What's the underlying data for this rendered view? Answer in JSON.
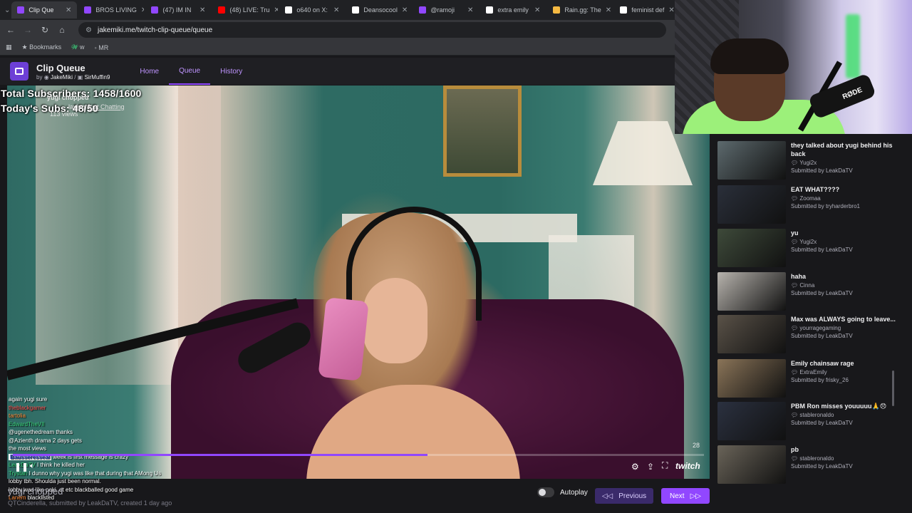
{
  "browser": {
    "tabs": [
      {
        "label": "Clip Que",
        "active": true,
        "color": "#9147ff"
      },
      {
        "label": "BROS LIVING",
        "active": false,
        "color": "#9147ff"
      },
      {
        "label": "(47) IM IN",
        "active": false,
        "color": "#9147ff"
      },
      {
        "label": "(48) LIVE: Tru",
        "active": false,
        "color": "#ff0000"
      },
      {
        "label": "o640 on X:",
        "active": false,
        "color": "#ffffff"
      },
      {
        "label": "Deansocool",
        "active": false,
        "color": "#ffffff"
      },
      {
        "label": "@ramoji",
        "active": false,
        "color": "#9147ff"
      },
      {
        "label": "extra emily",
        "active": false,
        "color": "#ffffff"
      },
      {
        "label": "Rain.gg: The",
        "active": false,
        "color": "#f5b942"
      },
      {
        "label": "feminist def",
        "active": false,
        "color": "#ffffff"
      }
    ],
    "url": "jakemiki.me/twitch-clip-queue/queue",
    "bookmarks": [
      {
        "label": "Bookmarks"
      },
      {
        "label": "w"
      },
      {
        "label": "MR"
      }
    ]
  },
  "app": {
    "title": "Clip Queue",
    "by_prefix": "by",
    "author1": "JakeMiki",
    "separator": "/",
    "author2": "SirMuffin9",
    "nav": [
      "Home",
      "Queue",
      "History"
    ],
    "active_nav": "Queue"
  },
  "player": {
    "clip_title_overlay": "yugi chopped",
    "playing_prefix": "laying",
    "category": "Just Chatting",
    "views": "113 views",
    "subs_total": "Total Subscribers: 1458/1600",
    "subs_today": "Today's Subs: 48/50",
    "counter": "28",
    "progress": 0.6,
    "watermark": "twitch"
  },
  "chat": [
    {
      "name": "",
      "text": "again yugi sure",
      "cls": ""
    },
    {
      "name": "theblackgamer",
      "text": "",
      "cls": "n1"
    },
    {
      "name": "tartolia",
      "text": "",
      "cls": "n2"
    },
    {
      "name": "EdwardTheVII",
      "text": "",
      "cls": "n3"
    },
    {
      "name": "",
      "text": "@ugenethedream thanks",
      "cls": ""
    },
    {
      "name": "",
      "text": "@Azienth drama 2 days gets",
      "cls": ""
    },
    {
      "name": "",
      "text": "the most views",
      "cls": ""
    },
    {
      "name": "Bausseresseal",
      "text": "week is first message is crazy",
      "cls": "badge"
    },
    {
      "name": "LeakDaTV",
      "text": "I think he killed her",
      "cls": "n3"
    },
    {
      "name": "Trystah",
      "text": "I dunno why yugi was like that during that AMong Us lobby tbh. Shoulda just been normal.",
      "cls": "n3"
    },
    {
      "name": "",
      "text": "lobby was like poki, qt etc blackballed good game",
      "cls": ""
    },
    {
      "name": "Lanem",
      "text": "blacklisted",
      "cls": "n2"
    }
  ],
  "bottom": {
    "clip_title": "yugi chopped",
    "meta": "QTCinderella, submitted by LeakDaTV, created 1 day ago",
    "autoplay_label": "Autoplay",
    "prev_label": "Previous",
    "next_label": "Next"
  },
  "queue": [
    {
      "title": "they talked about yugi behind his back",
      "channel": "Yugi2x",
      "submitted_by": "LeakDaTV",
      "thumb": "#5d6a6e"
    },
    {
      "title": "EAT WHAT????",
      "channel": "Zoomaa",
      "submitted_by": "tryharderbro1",
      "thumb": "#2a2f3a"
    },
    {
      "title": "yu",
      "channel": "Yugi2x",
      "submitted_by": "LeakDaTV",
      "thumb": "#3e4a3a"
    },
    {
      "title": "haha",
      "channel": "Cinna",
      "submitted_by": "LeakDaTV",
      "thumb": "#b7b3ad"
    },
    {
      "title": "Max was ALWAYS going to leave...",
      "channel": "yourragegaming",
      "submitted_by": "LeakDaTV",
      "thumb": "#5a5248"
    },
    {
      "title": "Emily chainsaw rage",
      "channel": "ExtraEmily",
      "submitted_by": "frisky_26",
      "thumb": "#8a7458"
    },
    {
      "title": "PBM Ron misses youuuuu🙏😞",
      "channel": "stableronaldo",
      "submitted_by": "LeakDaTV",
      "thumb": "#2b3140"
    },
    {
      "title": "pb",
      "channel": "stableronaldo",
      "submitted_by": "LeakDaTV",
      "thumb": "#6a6459"
    }
  ],
  "submitted_prefix": "Submitted by",
  "webcam": {
    "mic_brand": "RØDE"
  }
}
